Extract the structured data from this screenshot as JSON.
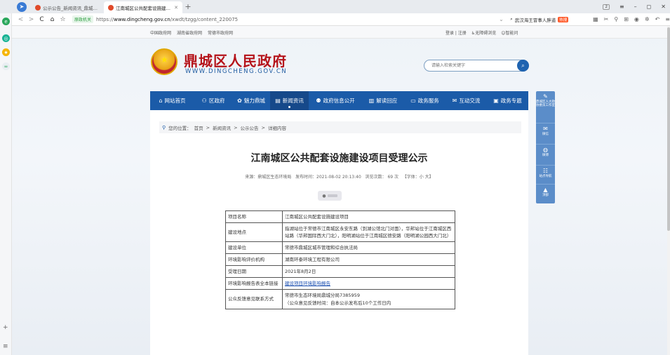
{
  "browser": {
    "tabs": [
      {
        "title": "公示公告_新闻资讯_鼎城区人民..."
      },
      {
        "title": "江南城区公共配套设施建设项目"
      }
    ],
    "new_tab_symbol": "+",
    "window_controls": {
      "badge": "2",
      "menu": "≡",
      "minimize": "–",
      "restore": "◻",
      "close": "✕"
    },
    "nav": {
      "back": "<",
      "forward": ">",
      "reload": "C",
      "home": "⌂",
      "bookmark": "☆"
    },
    "security_label": "原政机关",
    "url_prefix": "https://",
    "url_domain": "www.dingcheng.gov.cn",
    "url_path": "/xwdt/tzgg/content_220075",
    "search_text": "武汉海王冒事人胖道",
    "search_badge": "热搜"
  },
  "site": {
    "topbar_left": [
      "中国政府网",
      "湖南省政府网",
      "常德市政府网"
    ],
    "topbar_right": [
      "登录 | 注册",
      "无障碍浏览",
      "智能问"
    ],
    "name": "鼎城区人民政府",
    "domain": "WWW.DINGCHENG.GOV.CN",
    "search_placeholder": "请输入检索关键字",
    "nav": [
      {
        "label": "网站首页",
        "active": false
      },
      {
        "label": "区政府",
        "active": false
      },
      {
        "label": "魅力鼎城",
        "active": false
      },
      {
        "label": "新闻资讯",
        "active": true
      },
      {
        "label": "政府信息公开",
        "active": false
      },
      {
        "label": "解读回应",
        "active": false
      },
      {
        "label": "政务服务",
        "active": false
      },
      {
        "label": "互动交流",
        "active": false
      },
      {
        "label": "政务专题",
        "active": false
      }
    ],
    "accent": "#1b5ba8",
    "brand_red": "#b5131a"
  },
  "article": {
    "crumb_lead": "您的位置：",
    "crumbs": [
      "首页",
      "新闻资讯",
      "公示公告",
      "详细内容"
    ],
    "title": "江南城区公共配套设施建设项目受理公示",
    "meta": {
      "source": "来源：鼎城区生态环境局",
      "time": "发布时间：2021-08-02 20:13:40",
      "views": "浏览次数：",
      "views_count": "69",
      "views_unit": "次",
      "font": "【字体：小 大】"
    },
    "rows": [
      {
        "key": "项目名称",
        "value": "江南城区公共配套设施建设项目"
      },
      {
        "key": "建设地点",
        "value": "指湖站位于常德市江南城区永安东路（到湖公馆北门对面），华邦站位于江南城区西站路（华邦国际西大门北），阳明湖站位于江南城区德安路（阳明湖公园西大门北）"
      },
      {
        "key": "建设单位",
        "value": "常德市鼎城区城市管理和综合执法局"
      },
      {
        "key": "环境影响评价机构",
        "value": "湖南环泰环境工程有限公司"
      },
      {
        "key": "受理日期",
        "value": "2021年8月2日"
      },
      {
        "key": "环境影响报告表全本链接",
        "value": "建设项目环境影响报告",
        "link": true
      },
      {
        "key": "公众反馈意见联系方式",
        "value": "常德市生态环境局鼎城分局7385959",
        "value2": "（公众意见反馈时间：自本公示发布后10个工作日内"
      }
    ]
  },
  "right_sidebar": [
    {
      "icon": "edit-icon",
      "label": "鼎城区人大政协委员工作室"
    },
    {
      "icon": "wechat-icon",
      "label": "微信"
    },
    {
      "icon": "weibo-icon",
      "label": "微博"
    },
    {
      "icon": "sitemap-icon",
      "label": "站点导航"
    },
    {
      "icon": "arrow-up-icon",
      "label": "顶部"
    }
  ]
}
